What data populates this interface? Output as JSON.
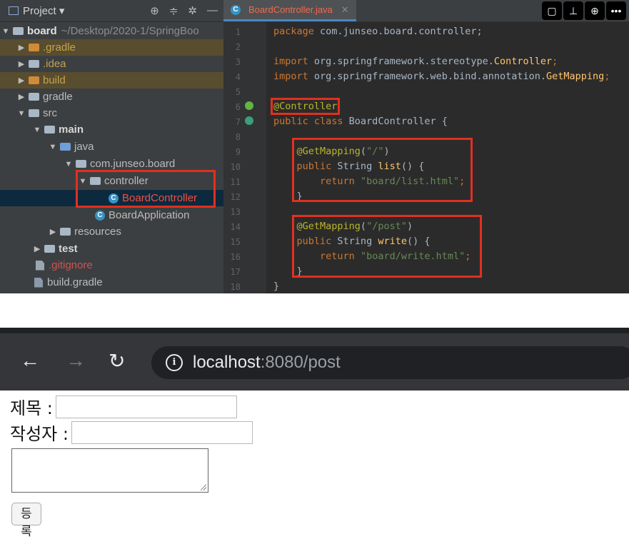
{
  "ide": {
    "project_header": {
      "title": "Project ▾"
    },
    "tree": [
      {
        "name": "tree-item-board",
        "label": "board",
        "extra": "~/Desktop/2020-1/SpringBoo"
      },
      {
        "name": "tree-item-gradle-hidden",
        "label": ".gradle"
      },
      {
        "name": "tree-item-idea",
        "label": ".idea"
      },
      {
        "name": "tree-item-build",
        "label": "build"
      },
      {
        "name": "tree-item-gradle",
        "label": "gradle"
      },
      {
        "name": "tree-item-src",
        "label": "src"
      },
      {
        "name": "tree-item-main",
        "label": "main"
      },
      {
        "name": "tree-item-java",
        "label": "java"
      },
      {
        "name": "tree-item-package",
        "label": "com.junseo.board"
      },
      {
        "name": "tree-item-controller",
        "label": "controller"
      },
      {
        "name": "tree-item-boardcontroller",
        "label": "BoardController"
      },
      {
        "name": "tree-item-boardapplication",
        "label": "BoardApplication"
      },
      {
        "name": "tree-item-resources",
        "label": "resources"
      },
      {
        "name": "tree-item-test",
        "label": "test"
      },
      {
        "name": "tree-item-gitignore",
        "label": ".gitignore"
      },
      {
        "name": "tree-item-buildgradle",
        "label": "build.gradle"
      }
    ],
    "tab": {
      "label": "BoardController.java"
    },
    "line_numbers": [
      "1",
      "2",
      "3",
      "4",
      "5",
      "6",
      "7",
      "8",
      "9",
      "10",
      "11",
      "12",
      "13",
      "14",
      "15",
      "16",
      "17",
      "18"
    ],
    "code": {
      "l1_kw": "package",
      "l1_rest": " com.junseo.board.controller;",
      "l3_kw": "import",
      "l3_rest": " org.springframework.stereotype.",
      "l3_cls": "Controller",
      "l3_end": ";",
      "l4_kw": "import",
      "l4_rest": " org.springframework.web.bind.annotation.",
      "l4_cls": "GetMapping",
      "l4_end": ";",
      "l6_ann": "@Controller",
      "l7_kw": "public class",
      "l7_rest": " BoardController {",
      "l9_ann": "@GetMapping",
      "l9_p1": "(",
      "l9_str": "\"/\"",
      "l9_p2": ")",
      "l10_kw": "public",
      "l10_rest": " String ",
      "l10_fn": "list",
      "l10_end": "() {",
      "l11_kw": "return",
      "l11_str": " \"board/list.html\"",
      "l11_end": ";",
      "l12": "}",
      "l14_ann": "@GetMapping",
      "l14_p1": "(",
      "l14_str": "\"/post\"",
      "l14_p2": ")",
      "l15_kw": "public",
      "l15_rest": " String ",
      "l15_fn": "write",
      "l15_end": "() {",
      "l16_kw": "return",
      "l16_str": " \"board/write.html\"",
      "l16_end": ";",
      "l17": "}",
      "l18": "}"
    },
    "toolbar_icons": [
      "comment-icon",
      "presenter-icon",
      "download-icon",
      "more-icon"
    ]
  },
  "browser": {
    "url_host": "localhost",
    "url_rest": ":8080/post",
    "form": {
      "title_label": "제목 :",
      "author_label": "작성자 :",
      "title_value": "",
      "author_value": "",
      "content_value": "",
      "submit_label": "등록"
    }
  },
  "colors": {
    "highlight_box": "#e03020",
    "ide_bg": "#2b2b2b",
    "browser_bar": "#35363a"
  }
}
